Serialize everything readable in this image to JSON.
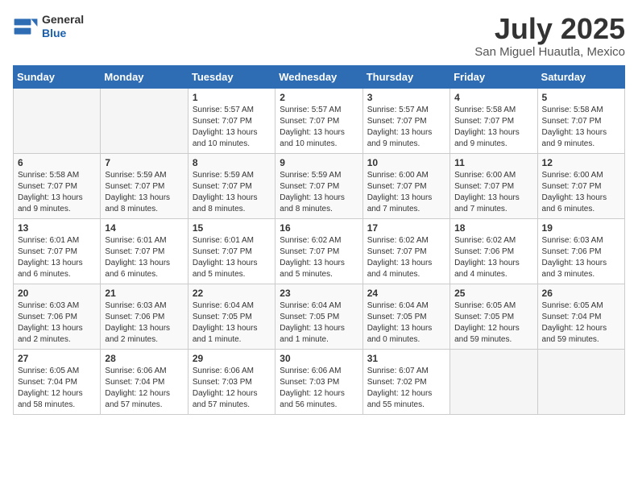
{
  "header": {
    "logo_general": "General",
    "logo_blue": "Blue",
    "month_title": "July 2025",
    "location": "San Miguel Huautla, Mexico"
  },
  "weekdays": [
    "Sunday",
    "Monday",
    "Tuesday",
    "Wednesday",
    "Thursday",
    "Friday",
    "Saturday"
  ],
  "weeks": [
    [
      {
        "day": "",
        "info": ""
      },
      {
        "day": "",
        "info": ""
      },
      {
        "day": "1",
        "info": "Sunrise: 5:57 AM\nSunset: 7:07 PM\nDaylight: 13 hours\nand 10 minutes."
      },
      {
        "day": "2",
        "info": "Sunrise: 5:57 AM\nSunset: 7:07 PM\nDaylight: 13 hours\nand 10 minutes."
      },
      {
        "day": "3",
        "info": "Sunrise: 5:57 AM\nSunset: 7:07 PM\nDaylight: 13 hours\nand 9 minutes."
      },
      {
        "day": "4",
        "info": "Sunrise: 5:58 AM\nSunset: 7:07 PM\nDaylight: 13 hours\nand 9 minutes."
      },
      {
        "day": "5",
        "info": "Sunrise: 5:58 AM\nSunset: 7:07 PM\nDaylight: 13 hours\nand 9 minutes."
      }
    ],
    [
      {
        "day": "6",
        "info": "Sunrise: 5:58 AM\nSunset: 7:07 PM\nDaylight: 13 hours\nand 9 minutes."
      },
      {
        "day": "7",
        "info": "Sunrise: 5:59 AM\nSunset: 7:07 PM\nDaylight: 13 hours\nand 8 minutes."
      },
      {
        "day": "8",
        "info": "Sunrise: 5:59 AM\nSunset: 7:07 PM\nDaylight: 13 hours\nand 8 minutes."
      },
      {
        "day": "9",
        "info": "Sunrise: 5:59 AM\nSunset: 7:07 PM\nDaylight: 13 hours\nand 8 minutes."
      },
      {
        "day": "10",
        "info": "Sunrise: 6:00 AM\nSunset: 7:07 PM\nDaylight: 13 hours\nand 7 minutes."
      },
      {
        "day": "11",
        "info": "Sunrise: 6:00 AM\nSunset: 7:07 PM\nDaylight: 13 hours\nand 7 minutes."
      },
      {
        "day": "12",
        "info": "Sunrise: 6:00 AM\nSunset: 7:07 PM\nDaylight: 13 hours\nand 6 minutes."
      }
    ],
    [
      {
        "day": "13",
        "info": "Sunrise: 6:01 AM\nSunset: 7:07 PM\nDaylight: 13 hours\nand 6 minutes."
      },
      {
        "day": "14",
        "info": "Sunrise: 6:01 AM\nSunset: 7:07 PM\nDaylight: 13 hours\nand 6 minutes."
      },
      {
        "day": "15",
        "info": "Sunrise: 6:01 AM\nSunset: 7:07 PM\nDaylight: 13 hours\nand 5 minutes."
      },
      {
        "day": "16",
        "info": "Sunrise: 6:02 AM\nSunset: 7:07 PM\nDaylight: 13 hours\nand 5 minutes."
      },
      {
        "day": "17",
        "info": "Sunrise: 6:02 AM\nSunset: 7:07 PM\nDaylight: 13 hours\nand 4 minutes."
      },
      {
        "day": "18",
        "info": "Sunrise: 6:02 AM\nSunset: 7:06 PM\nDaylight: 13 hours\nand 4 minutes."
      },
      {
        "day": "19",
        "info": "Sunrise: 6:03 AM\nSunset: 7:06 PM\nDaylight: 13 hours\nand 3 minutes."
      }
    ],
    [
      {
        "day": "20",
        "info": "Sunrise: 6:03 AM\nSunset: 7:06 PM\nDaylight: 13 hours\nand 2 minutes."
      },
      {
        "day": "21",
        "info": "Sunrise: 6:03 AM\nSunset: 7:06 PM\nDaylight: 13 hours\nand 2 minutes."
      },
      {
        "day": "22",
        "info": "Sunrise: 6:04 AM\nSunset: 7:05 PM\nDaylight: 13 hours\nand 1 minute."
      },
      {
        "day": "23",
        "info": "Sunrise: 6:04 AM\nSunset: 7:05 PM\nDaylight: 13 hours\nand 1 minute."
      },
      {
        "day": "24",
        "info": "Sunrise: 6:04 AM\nSunset: 7:05 PM\nDaylight: 13 hours\nand 0 minutes."
      },
      {
        "day": "25",
        "info": "Sunrise: 6:05 AM\nSunset: 7:05 PM\nDaylight: 12 hours\nand 59 minutes."
      },
      {
        "day": "26",
        "info": "Sunrise: 6:05 AM\nSunset: 7:04 PM\nDaylight: 12 hours\nand 59 minutes."
      }
    ],
    [
      {
        "day": "27",
        "info": "Sunrise: 6:05 AM\nSunset: 7:04 PM\nDaylight: 12 hours\nand 58 minutes."
      },
      {
        "day": "28",
        "info": "Sunrise: 6:06 AM\nSunset: 7:04 PM\nDaylight: 12 hours\nand 57 minutes."
      },
      {
        "day": "29",
        "info": "Sunrise: 6:06 AM\nSunset: 7:03 PM\nDaylight: 12 hours\nand 57 minutes."
      },
      {
        "day": "30",
        "info": "Sunrise: 6:06 AM\nSunset: 7:03 PM\nDaylight: 12 hours\nand 56 minutes."
      },
      {
        "day": "31",
        "info": "Sunrise: 6:07 AM\nSunset: 7:02 PM\nDaylight: 12 hours\nand 55 minutes."
      },
      {
        "day": "",
        "info": ""
      },
      {
        "day": "",
        "info": ""
      }
    ]
  ]
}
